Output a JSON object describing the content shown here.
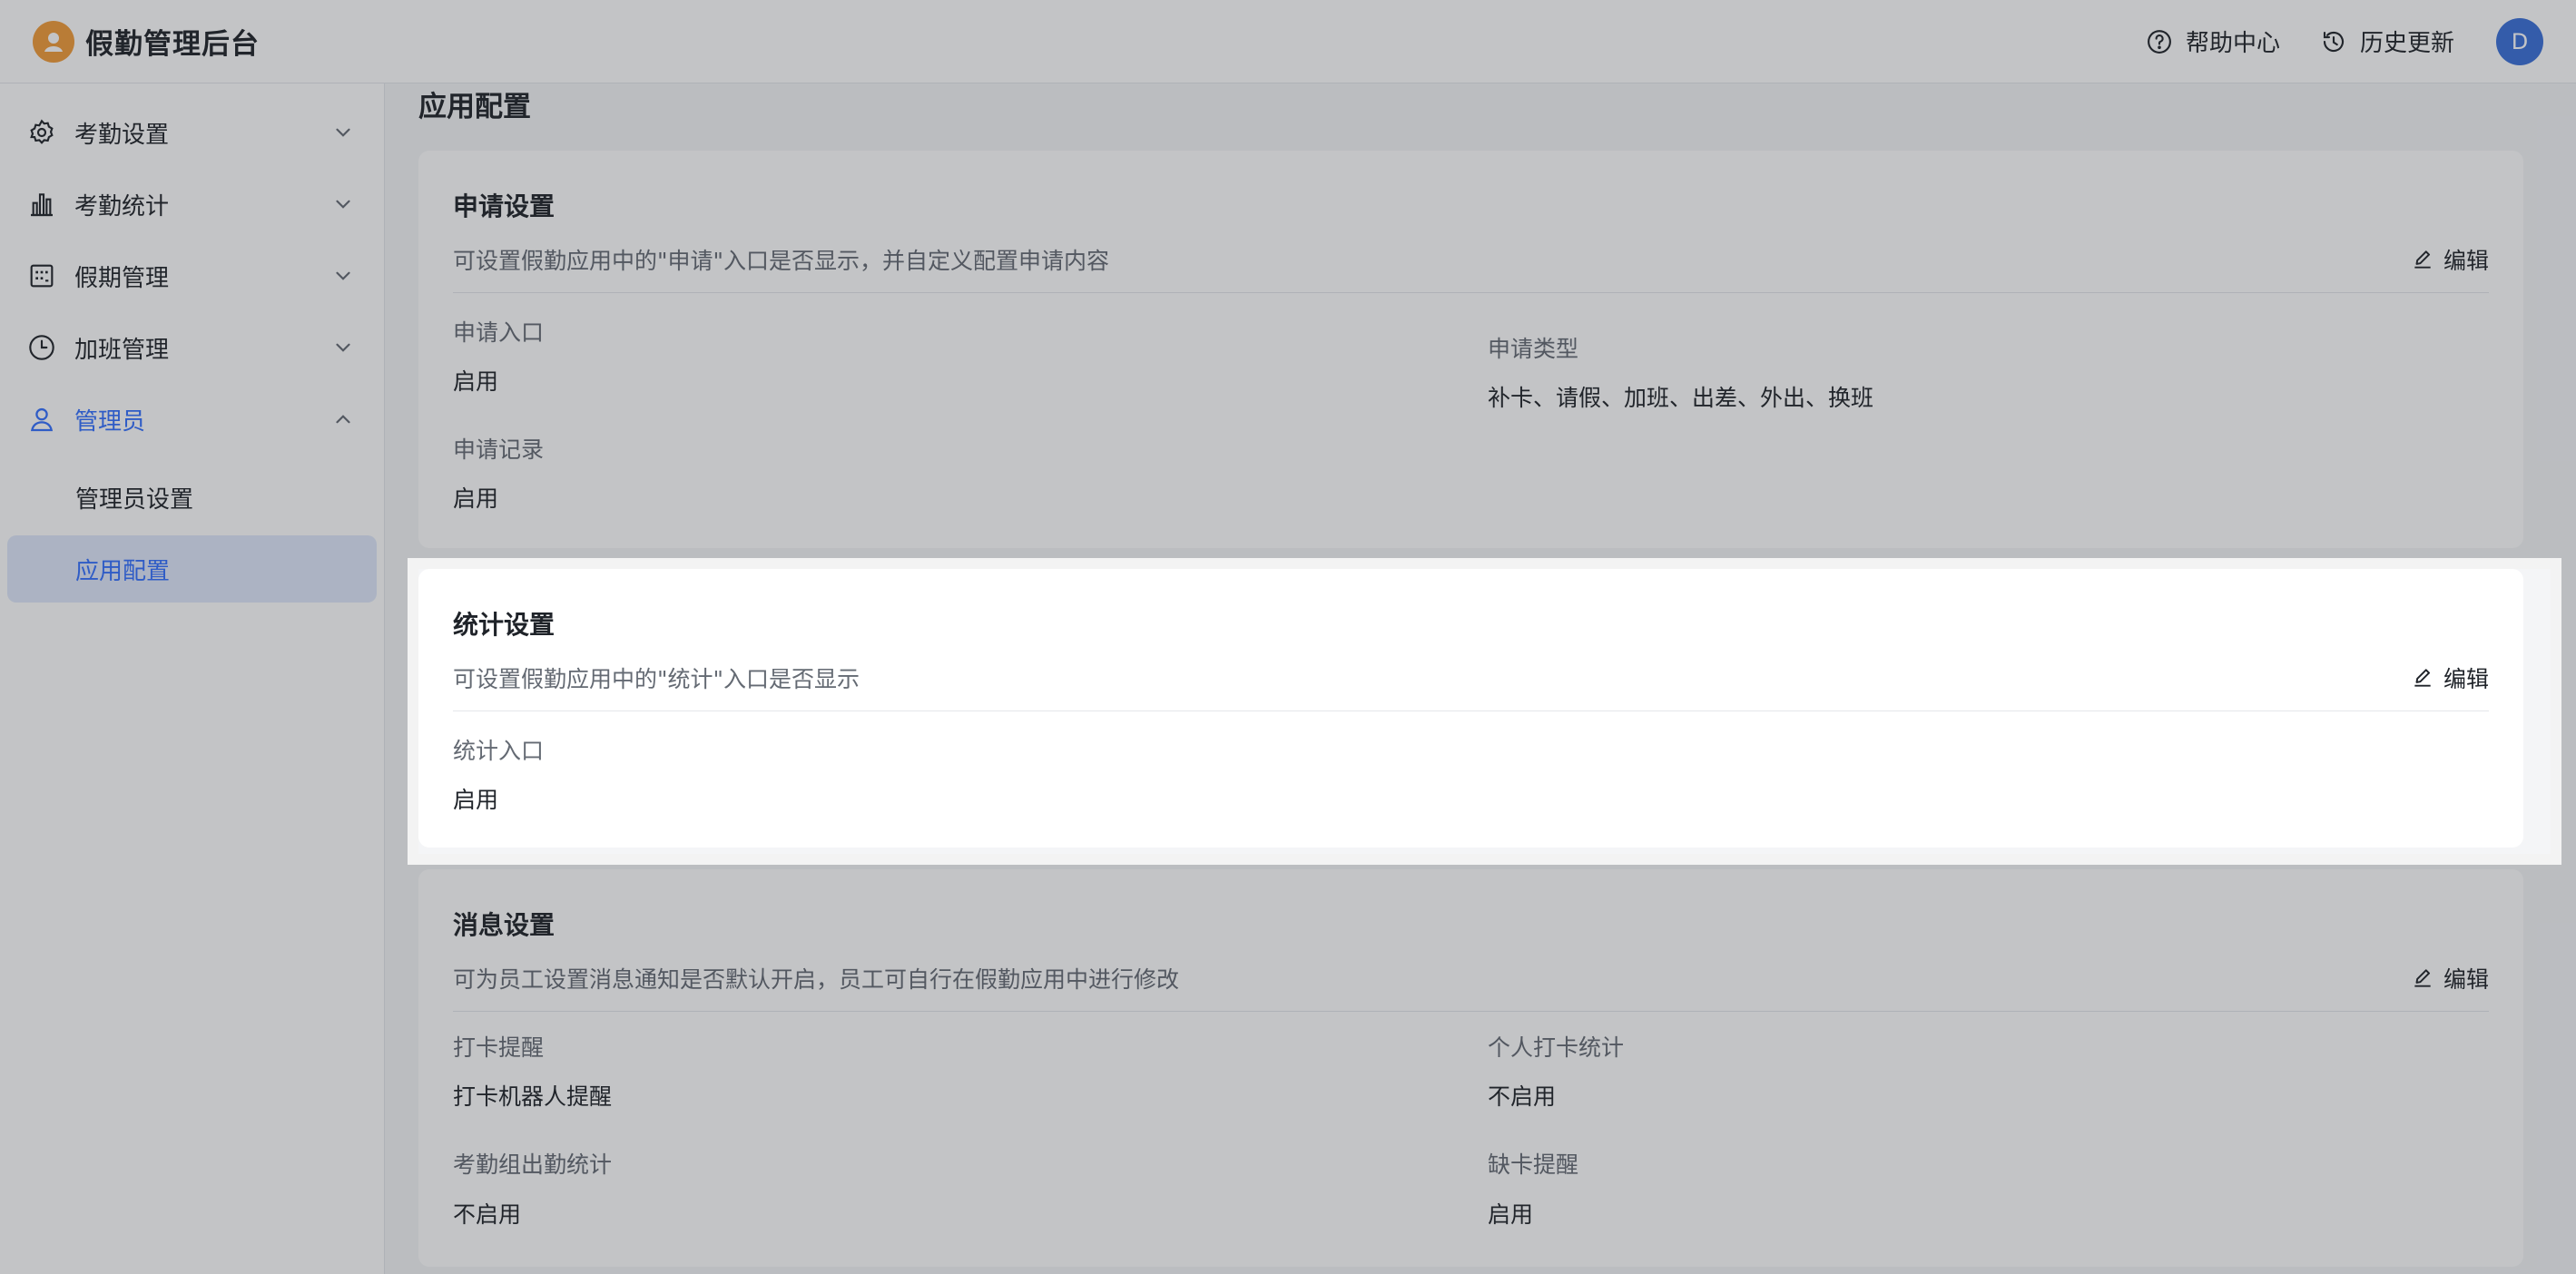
{
  "app": {
    "title": "假勤管理后台"
  },
  "header": {
    "help_label": "帮助中心",
    "history_label": "历史更新",
    "avatar_initial": "D"
  },
  "sidebar": {
    "items": [
      {
        "label": "考勤设置",
        "icon": "gear-icon"
      },
      {
        "label": "考勤统计",
        "icon": "bar-chart-icon"
      },
      {
        "label": "假期管理",
        "icon": "calendar-icon"
      },
      {
        "label": "加班管理",
        "icon": "clock-icon"
      },
      {
        "label": "管理员",
        "icon": "user-icon"
      }
    ],
    "sub_items": [
      {
        "label": "管理员设置"
      },
      {
        "label": "应用配置"
      }
    ]
  },
  "main": {
    "page_title": "应用配置",
    "edit_label": "编辑",
    "apply": {
      "title": "申请设置",
      "desc": "可设置假勤应用中的\"申请\"入口是否显示，并自定义配置申请内容",
      "entry_label": "申请入口",
      "entry_value": "启用",
      "record_label": "申请记录",
      "record_value": "启用",
      "type_label": "申请类型",
      "type_value": "补卡、请假、加班、出差、外出、换班"
    },
    "stats": {
      "title": "统计设置",
      "desc": "可设置假勤应用中的\"统计\"入口是否显示",
      "entry_label": "统计入口",
      "entry_value": "启用"
    },
    "message": {
      "title": "消息设置",
      "desc": "可为员工设置消息通知是否默认开启，员工可自行在假勤应用中进行修改",
      "clockin_label": "打卡提醒",
      "clockin_value": "打卡机器人提醒",
      "personal_label": "个人打卡统计",
      "personal_value": "不启用",
      "group_label": "考勤组出勤统计",
      "group_value": "不启用",
      "missing_label": "缺卡提醒",
      "missing_value": "启用"
    }
  },
  "colors": {
    "accent": "#3370ff",
    "logo": "#f29b38",
    "avatar": "#3a6fd8"
  }
}
